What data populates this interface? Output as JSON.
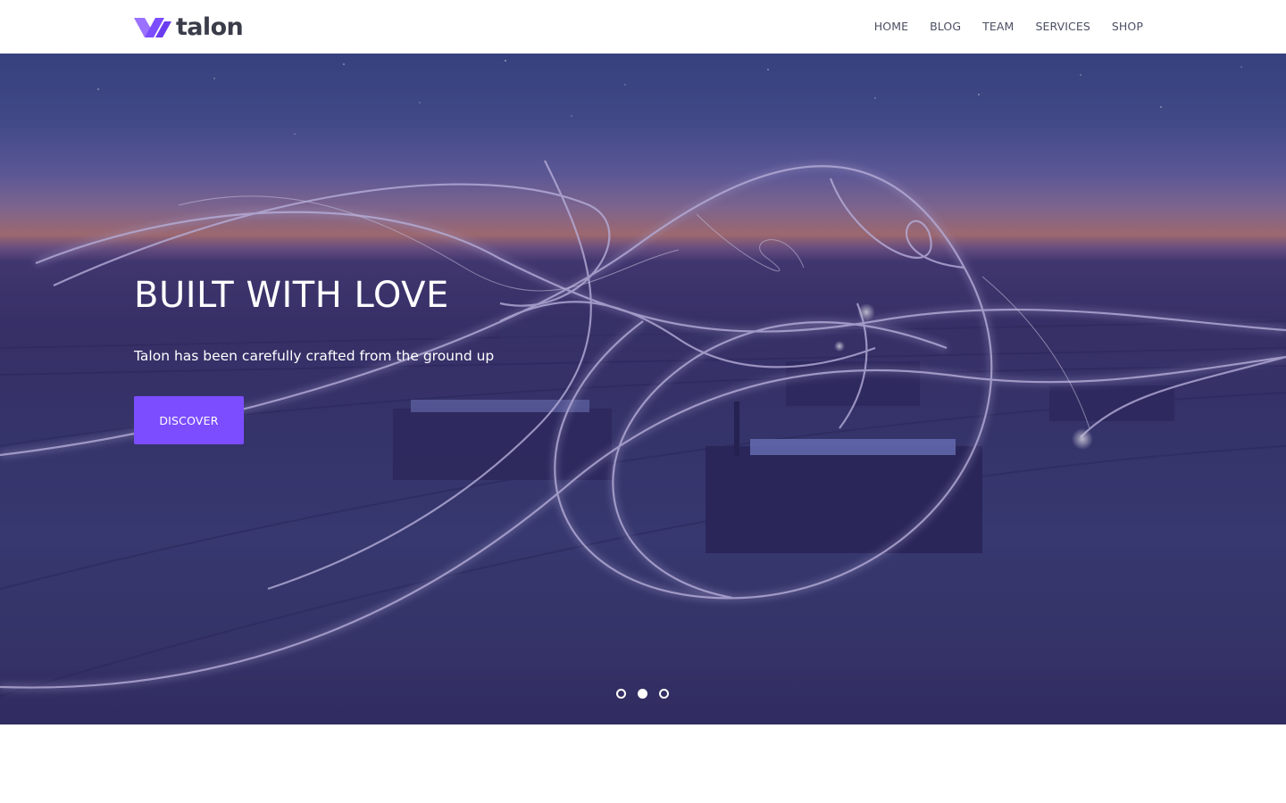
{
  "brand": {
    "name": "talon",
    "logo_icon": "talon-chevron-logo",
    "accent_color": "#7c4dff"
  },
  "nav": {
    "items": [
      {
        "label": "HOME"
      },
      {
        "label": "BLOG"
      },
      {
        "label": "TEAM"
      },
      {
        "label": "SERVICES"
      },
      {
        "label": "SHOP"
      }
    ]
  },
  "hero": {
    "title": "BUILT WITH LOVE",
    "subtitle": "Talon has been carefully crafted from the ground up",
    "cta_label": "DISCOVER",
    "background": "rooftop-light-painting-photo",
    "slides": {
      "total": 3,
      "active": 2
    }
  }
}
